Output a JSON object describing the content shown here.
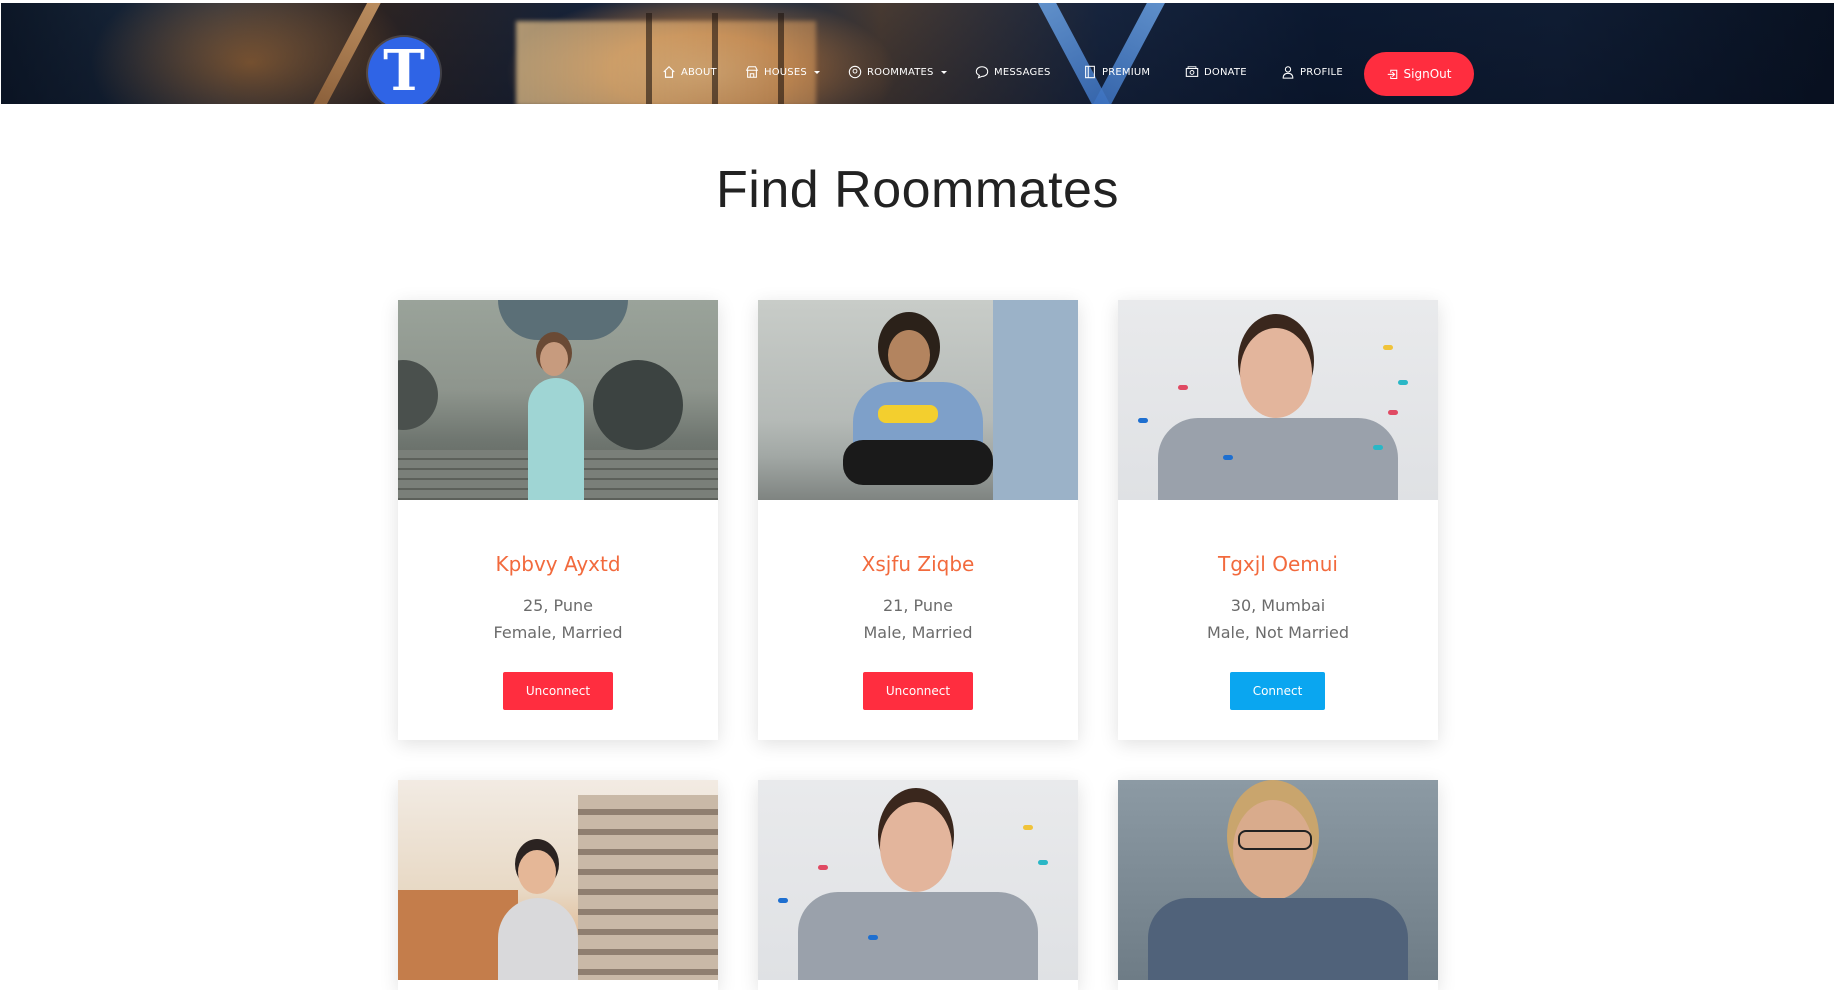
{
  "brand": {
    "logo_letter": "T",
    "logo_color": "#2f64e6"
  },
  "nav": {
    "items": [
      {
        "label": "ABOUT",
        "icon": "home-icon",
        "dropdown": false
      },
      {
        "label": "HOUSES",
        "icon": "store-icon",
        "dropdown": true
      },
      {
        "label": "ROOMMATES",
        "icon": "user-circle-icon",
        "dropdown": true
      },
      {
        "label": "MESSAGES",
        "icon": "chat-bubble-icon",
        "dropdown": false
      },
      {
        "label": "PREMIUM",
        "icon": "book-icon",
        "dropdown": false
      },
      {
        "label": "DONATE",
        "icon": "money-icon",
        "dropdown": false
      },
      {
        "label": "PROFILE",
        "icon": "user-icon",
        "dropdown": false
      }
    ],
    "signout": {
      "label": "SignOut",
      "icon": "logout-icon",
      "color": "#ff2d3f"
    }
  },
  "page": {
    "title": "Find Roommates"
  },
  "colors": {
    "name": "#f26a3d",
    "unconnect": "#ff2d3f",
    "connect": "#0aa6f0"
  },
  "roommates": [
    {
      "name": "Kpbvy Ayxtd",
      "age_city": "25, Pune",
      "gender_status": "Female, Married",
      "action": "Unconnect"
    },
    {
      "name": "Xsjfu Ziqbe",
      "age_city": "21, Pune",
      "gender_status": "Male, Married",
      "action": "Unconnect"
    },
    {
      "name": "Tgxjl Oemui",
      "age_city": "30, Mumbai",
      "gender_status": "Male, Not Married",
      "action": "Connect"
    }
  ]
}
